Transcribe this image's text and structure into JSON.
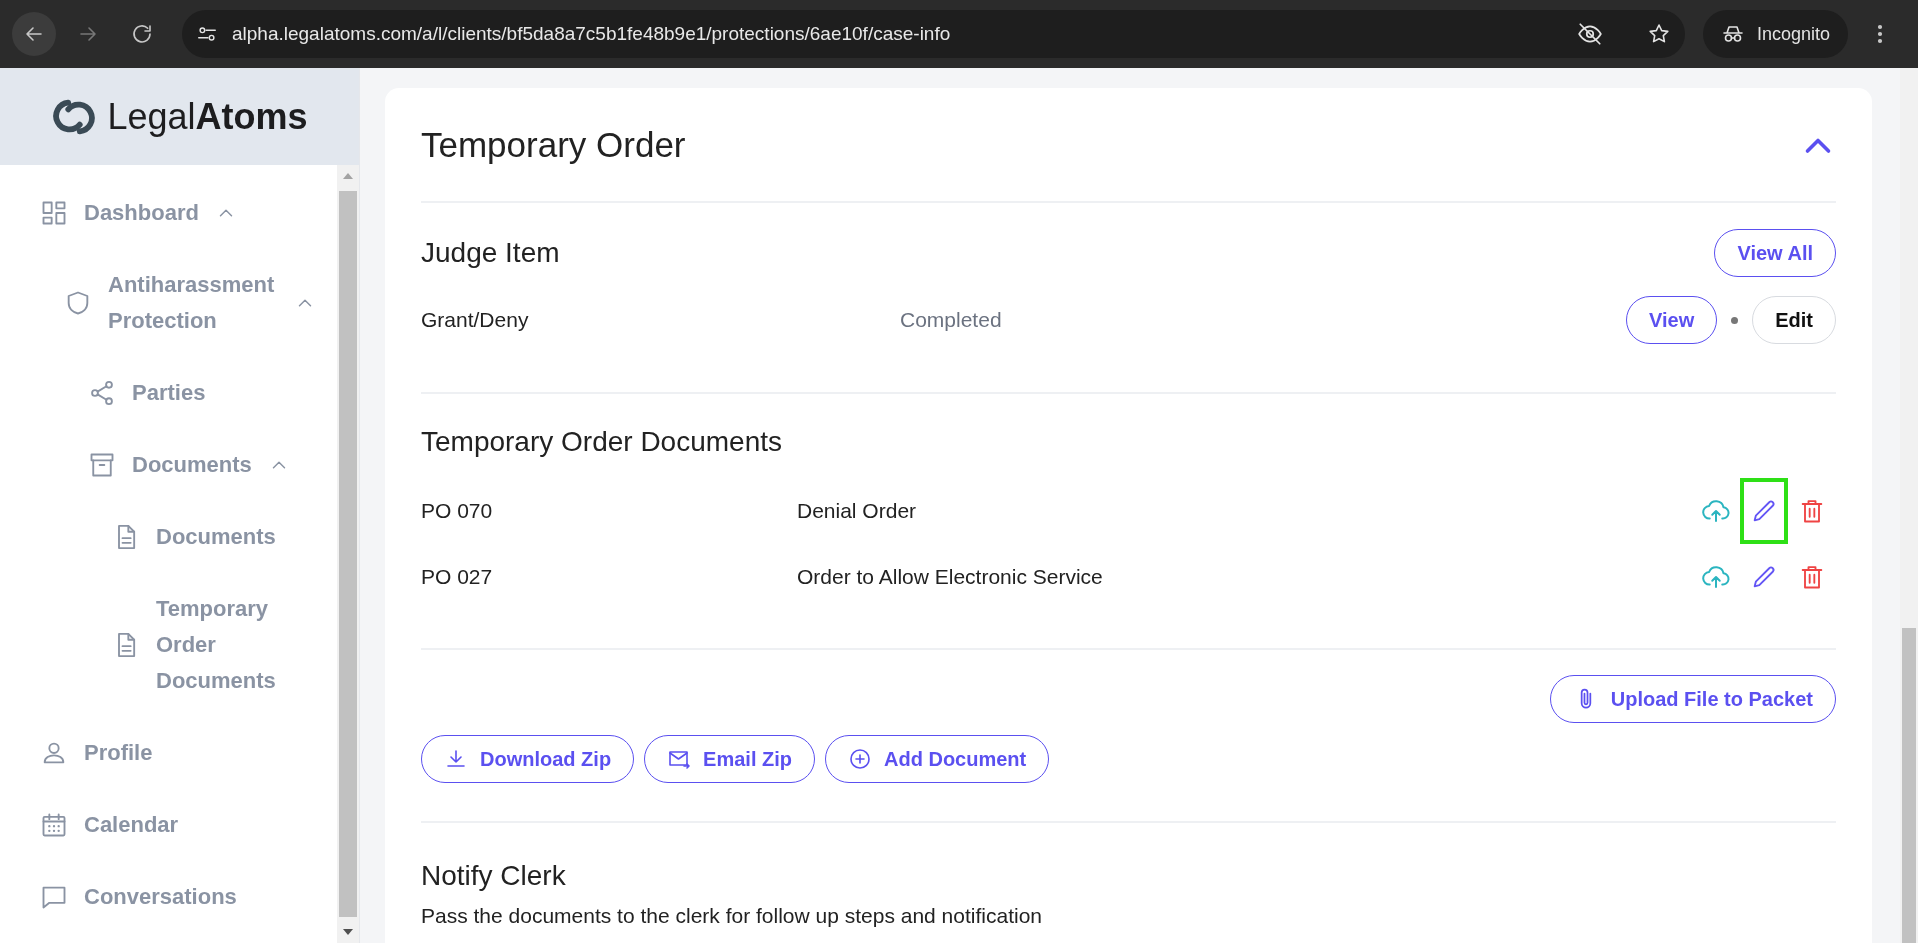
{
  "browser": {
    "url": "alpha.legalatoms.com/a/l/clients/bf5da8a7c5b1fe48b9e1/protections/6ae10f/case-info",
    "profile_label": "Incognito"
  },
  "brand": {
    "name": "Legal**Atoms**"
  },
  "sidebar": {
    "items": [
      {
        "label": "Dashboard",
        "expanded": true,
        "children": [
          {
            "label": "Antiharassment Protection",
            "expanded": true,
            "children": [
              {
                "label": "Parties"
              },
              {
                "label": "Documents",
                "expanded": true,
                "children": [
                  {
                    "label": "Documents"
                  },
                  {
                    "label": "Temporary Order Documents"
                  }
                ]
              }
            ]
          }
        ]
      },
      {
        "label": "Profile"
      },
      {
        "label": "Calendar"
      },
      {
        "label": "Conversations"
      }
    ]
  },
  "card": {
    "title": "Temporary Order",
    "expanded": true,
    "judge_items": {
      "heading": "Judge Item",
      "view_all": "View All",
      "rows": [
        {
          "name": "Grant/Deny",
          "status": "Completed",
          "view": "View",
          "edit": "Edit"
        }
      ]
    },
    "documents": {
      "heading": "Temporary Order Documents",
      "rows": [
        {
          "code": "PO 070",
          "title": "Denial Order",
          "highlighted": true
        },
        {
          "code": "PO 027",
          "title": "Order to Allow Electronic Service",
          "highlighted": false
        }
      ],
      "upload_button": "Upload File to Packet",
      "actions": [
        "Download Zip",
        "Email Zip",
        "Add Document"
      ]
    },
    "notify": {
      "heading": "Notify Clerk",
      "description": "Pass the documents to the clerk for follow up steps and notification"
    }
  }
}
